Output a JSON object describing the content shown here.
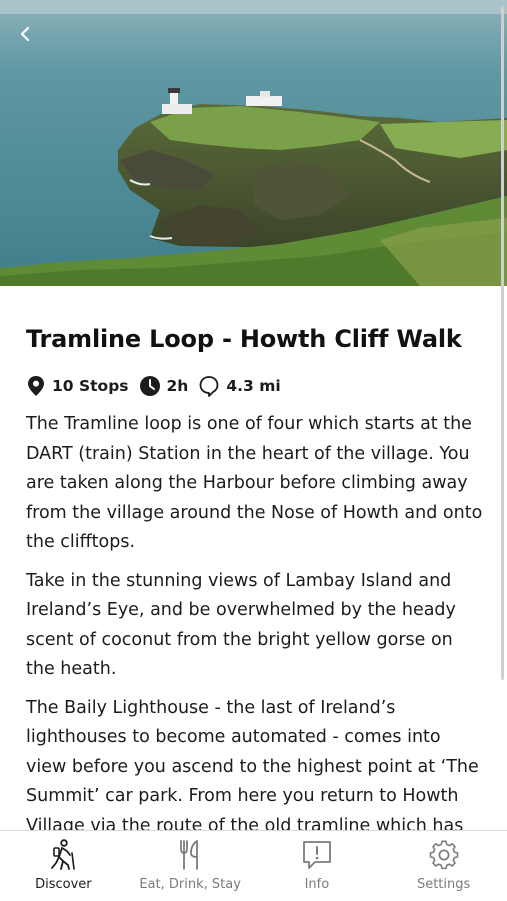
{
  "walk": {
    "title": "Tramline Loop - Howth Cliff Walk",
    "stops": "10 Stops",
    "duration": "2h",
    "distance": "4.3 mi",
    "paragraphs": [
      "The Tramline loop is one of four which starts at the DART (train) Station in the heart of the village. You are taken along the Harbour before climbing away from the village around the Nose of Howth and onto the clifftops.",
      "Take in the stunning views of Lambay Island and Ireland’s Eye, and be overwhelmed by the heady scent of coconut from the bright yellow gorse on the heath.",
      "The Baily Lighthouse - the last of Ireland’s lighthouses to become automated - comes into view before you ascend to the highest point at ‘The Summit’ car park. From here you return to Howth Village via the route of the old tramline which has"
    ]
  },
  "icons": {
    "back": "chevron-left-icon",
    "stops": "map-pin-icon",
    "duration": "clock-icon",
    "distance": "route-icon"
  },
  "tabs": [
    {
      "label": "Discover",
      "icon": "hiker-icon",
      "active": true
    },
    {
      "label": "Eat, Drink, Stay",
      "icon": "fork-knife-icon",
      "active": false
    },
    {
      "label": "Info",
      "icon": "info-bubble-icon",
      "active": false
    },
    {
      "label": "Settings",
      "icon": "gear-icon",
      "active": false
    }
  ],
  "colors": {
    "text": "#1c1c1c",
    "tab_inactive": "#7b7b7b",
    "sea": "#4f8f9a",
    "grass": "#6e9a45"
  }
}
